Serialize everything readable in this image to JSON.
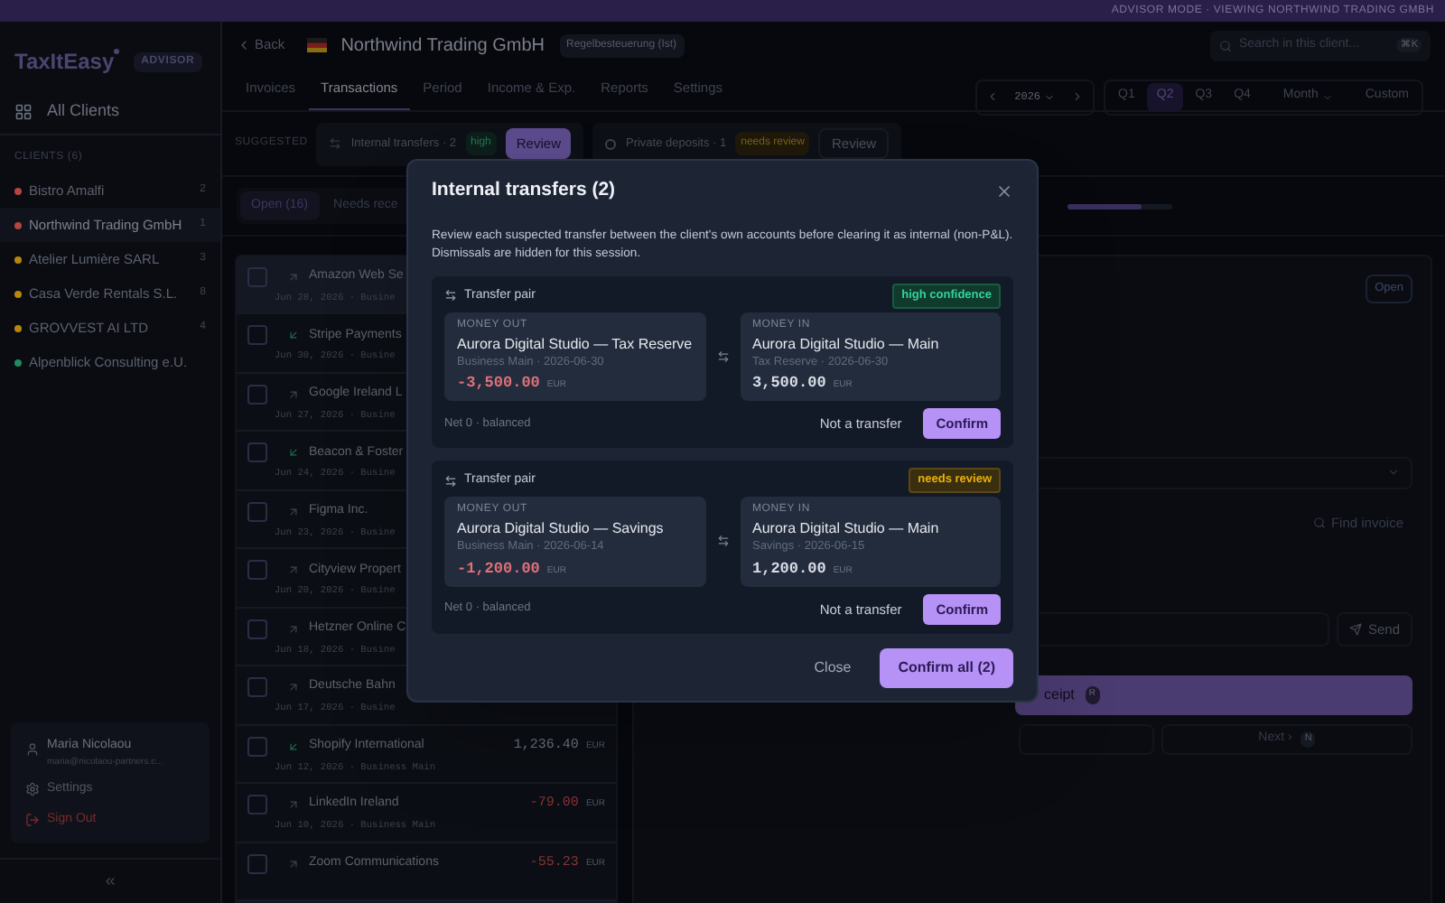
{
  "banner": {
    "text": "ADVISOR MODE · VIEWING NORTHWIND TRADING GMBH"
  },
  "sidebar": {
    "logo": "TaxItEasy",
    "badge": "ADVISOR",
    "all_clients": "All Clients",
    "clients_heading": "CLIENTS (6)",
    "clients": [
      {
        "name": "Bistro Amalfi",
        "count": "2",
        "color": "#b4453f",
        "selected": false
      },
      {
        "name": "Northwind Trading GmbH",
        "count": "1",
        "color": "#b4453f",
        "selected": true
      },
      {
        "name": "Atelier Lumière SARL",
        "count": "3",
        "color": "#b8860b",
        "selected": false
      },
      {
        "name": "Casa Verde Rentals S.L.",
        "count": "8",
        "color": "#b8860b",
        "selected": false
      },
      {
        "name": "GROVVEST AI LTD",
        "count": "4",
        "color": "#b8860b",
        "selected": false
      },
      {
        "name": "Alpenblick Consulting e.U.",
        "color": "#1f8a5b",
        "selected": false
      }
    ],
    "user": {
      "name": "Maria Nicolaou",
      "email": "maria@nicolaou-partners.c..."
    },
    "menu": [
      {
        "label": "Settings",
        "kind": "settings"
      },
      {
        "label": "Sign Out",
        "kind": "signout"
      }
    ]
  },
  "header": {
    "back": "Back",
    "client": "Northwind Trading GmbH",
    "tax_badge": "Regelbesteuerung (Ist)",
    "search_placeholder": "Search in this client...",
    "shortcut": "⌘K"
  },
  "tabs": [
    {
      "label": "Invoices",
      "selected": false
    },
    {
      "label": "Transactions",
      "selected": true
    },
    {
      "label": "Period",
      "selected": false
    },
    {
      "label": "Income & Exp.",
      "selected": false
    },
    {
      "label": "Reports",
      "selected": false
    },
    {
      "label": "Settings",
      "selected": false
    }
  ],
  "period": {
    "year": "2026",
    "options": [
      {
        "label": "Q1",
        "kind": "plain",
        "selected": false
      },
      {
        "label": "Q2",
        "kind": "plain",
        "selected": true
      },
      {
        "label": "Q3",
        "kind": "plain",
        "selected": false
      },
      {
        "label": "Q4",
        "kind": "plain",
        "selected": false
      },
      {
        "label": "Month",
        "kind": "dropdown",
        "selected": false
      },
      {
        "label": "Custom",
        "kind": "plain",
        "selected": false
      }
    ]
  },
  "suggestions": {
    "heading": "SUGGESTED",
    "items": [
      {
        "label": "Internal transfers · 2",
        "badge": "high",
        "kind": "high",
        "action": "Review",
        "selected": true
      },
      {
        "label": "Private deposits · 1",
        "badge": "needs review",
        "kind": "review",
        "action": "Review",
        "selected": false
      }
    ]
  },
  "filters": [
    {
      "label": "Open (16)",
      "selected": true
    },
    {
      "label": "Needs rece",
      "selected": false
    }
  ],
  "progress": {
    "level": 0.7
  },
  "transactions": [
    {
      "name": "Amazon Web Se",
      "date": "Jun 28, 2026 · Busine",
      "kind": "out",
      "selected": true
    },
    {
      "name": "Stripe Payments",
      "date": "Jun 30, 2026 · Busine",
      "kind": "in",
      "selected": false
    },
    {
      "name": "Google Ireland L",
      "date": "Jun 27, 2026 · Busine",
      "kind": "out",
      "selected": false
    },
    {
      "name": "Beacon & Foster",
      "date": "Jun 24, 2026 · Busine",
      "kind": "in",
      "selected": false
    },
    {
      "name": "Figma Inc.",
      "date": "Jun 23, 2026 · Busine",
      "kind": "out",
      "selected": false
    },
    {
      "name": "Cityview Propert",
      "date": "Jun 20, 2026 · Busine",
      "kind": "out",
      "selected": false
    },
    {
      "name": "Hetzner Online C",
      "date": "Jun 18, 2026 · Busine",
      "kind": "out",
      "selected": false
    },
    {
      "name": "Deutsche Bahn",
      "date": "Jun 17, 2026 · Busine",
      "kind": "out",
      "selected": false
    },
    {
      "name": "Shopify International",
      "date": "Jun 12, 2026 · Business Main",
      "amount": "1,236.40",
      "currency": "EUR",
      "kind": "in",
      "selected": false
    },
    {
      "name": "LinkedIn Ireland",
      "date": "Jun 10, 2026 · Business Main",
      "amount": "-79.00",
      "currency": "EUR",
      "kind": "out",
      "selected": false
    },
    {
      "name": "Zoom Communications",
      "amount": "-55.23",
      "currency": "EUR",
      "kind": "out",
      "selected": false
    }
  ],
  "detail": {
    "status": "Open",
    "find": "Find invoice",
    "send": "Send",
    "receipt": "ceipt",
    "receipt_key": "R",
    "next": "Next ›",
    "next_key": "N"
  },
  "modal": {
    "title": "Internal transfers (2)",
    "description": "Review each suspected transfer between the client's own accounts before clearing it as internal (non-P&L). Dismissals are hidden for this session.",
    "pairs": [
      {
        "header": "Transfer pair",
        "confidence": {
          "label": "high confidence",
          "kind": "high"
        },
        "out": {
          "label": "MONEY OUT",
          "account": "Aurora Digital Studio — Tax Reserve",
          "meta": "Business Main · 2026-06-30",
          "amount": "-3,500.00",
          "currency": "EUR"
        },
        "in": {
          "label": "MONEY IN",
          "account": "Aurora Digital Studio — Main",
          "meta": "Tax Reserve · 2026-06-30",
          "amount": "3,500.00",
          "currency": "EUR"
        },
        "net": "Net 0 · balanced",
        "dismiss": "Not a transfer",
        "confirm": "Confirm"
      },
      {
        "header": "Transfer pair",
        "confidence": {
          "label": "needs review",
          "kind": "review"
        },
        "out": {
          "label": "MONEY OUT",
          "account": "Aurora Digital Studio — Savings",
          "meta": "Business Main · 2026-06-14",
          "amount": "-1,200.00",
          "currency": "EUR"
        },
        "in": {
          "label": "MONEY IN",
          "account": "Aurora Digital Studio — Main",
          "meta": "Savings · 2026-06-15",
          "amount": "1,200.00",
          "currency": "EUR"
        },
        "net": "Net 0 · balanced",
        "dismiss": "Not a transfer",
        "confirm": "Confirm"
      }
    ],
    "close": "Close",
    "confirm_all": "Confirm all (2)"
  }
}
